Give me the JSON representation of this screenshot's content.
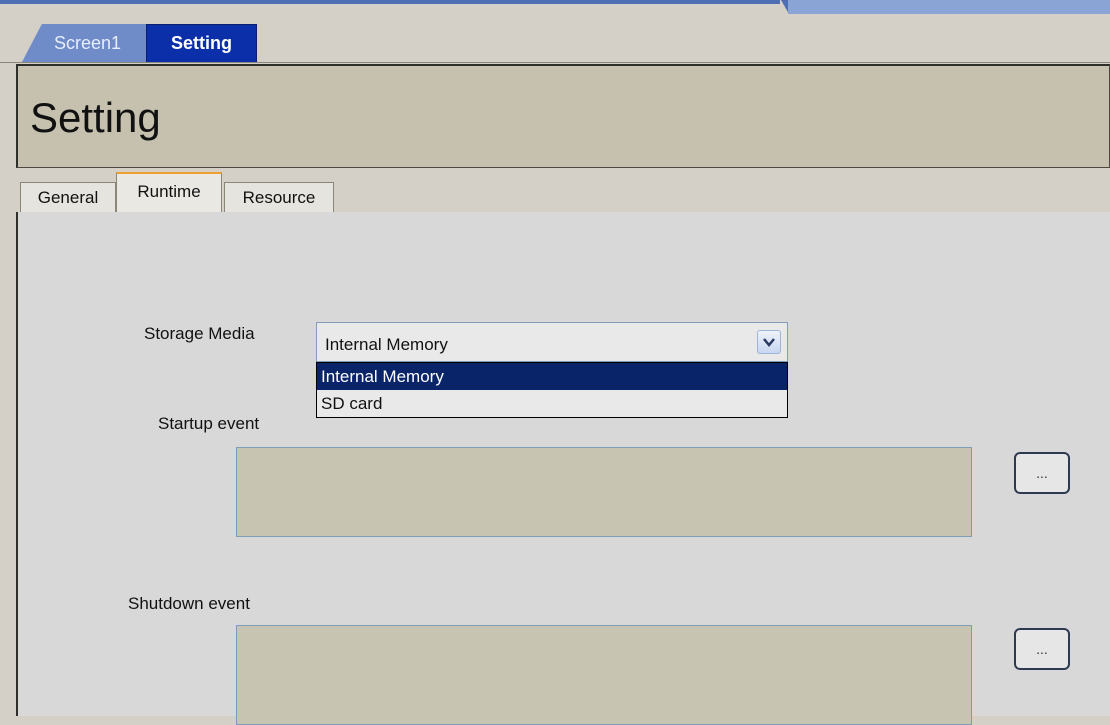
{
  "document_tabs": [
    {
      "label": "Screen1",
      "active": false
    },
    {
      "label": "Setting",
      "active": true
    }
  ],
  "page_title": "Setting",
  "property_tabs": [
    {
      "label": "General",
      "active": false
    },
    {
      "label": "Runtime",
      "active": true
    },
    {
      "label": "Resource",
      "active": false
    }
  ],
  "storage_media": {
    "label": "Storage Media",
    "selected": "Internal Memory",
    "dropdown_open": true,
    "options": [
      {
        "label": "Internal Memory",
        "highlighted": true
      },
      {
        "label": "SD card",
        "highlighted": false
      }
    ],
    "arrow_icon": "chevron-down-icon"
  },
  "startup_event": {
    "label": "Startup event",
    "value": "",
    "browse_label": "..."
  },
  "shutdown_event": {
    "label": "Shutdown event",
    "value": "",
    "browse_label": "..."
  },
  "colors": {
    "selected_tab": "#0b2fa8",
    "highlight": "#0a246a",
    "active_tab_accent": "#f0a030"
  }
}
